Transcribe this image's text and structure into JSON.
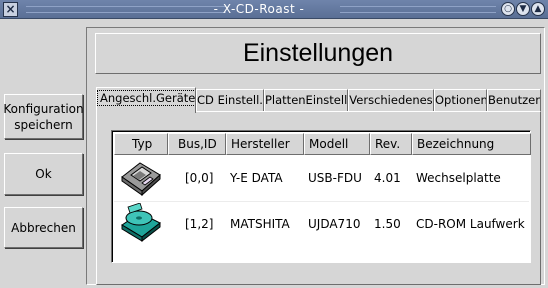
{
  "window": {
    "title": "- X-CD-Roast -",
    "close_glyph": "×",
    "iconify_glyph": "○",
    "minimize_glyph": "▼",
    "maximize_glyph": "▲"
  },
  "sidebar": {
    "save_config_line1": "Konfiguration",
    "save_config_line2": "speichern",
    "ok_label": "Ok",
    "cancel_label": "Abbrechen"
  },
  "main": {
    "heading": "Einstellungen",
    "tabs": [
      {
        "label": "Angeschl.Geräte",
        "active": true
      },
      {
        "label": "CD Einstell.",
        "active": false
      },
      {
        "label": "PlattenEinstell.",
        "active": false
      },
      {
        "label": "Verschiedenes",
        "active": false
      },
      {
        "label": "Optionen",
        "active": false
      },
      {
        "label": "Benutzer",
        "active": false
      }
    ]
  },
  "devices": {
    "columns": [
      "Typ",
      "Bus,ID",
      "Hersteller",
      "Modell",
      "Rev.",
      "Bezeichnung"
    ],
    "rows": [
      {
        "icon": "floppy-drive-icon",
        "bus_id": "[0,0]",
        "vendor": "Y-E DATA",
        "model": "USB-FDU",
        "rev": "4.01",
        "description": "Wechselplatte"
      },
      {
        "icon": "cd-rom-drive-icon",
        "bus_id": "[1,2]",
        "vendor": "MATSHITA",
        "model": "UJDA710",
        "rev": "1.50",
        "description": "CD-ROM Laufwerk"
      }
    ]
  },
  "colors": {
    "titlebar": "#5a6f95",
    "background": "#d6d6d6",
    "cd_icon_teal": "#1fa59a"
  }
}
